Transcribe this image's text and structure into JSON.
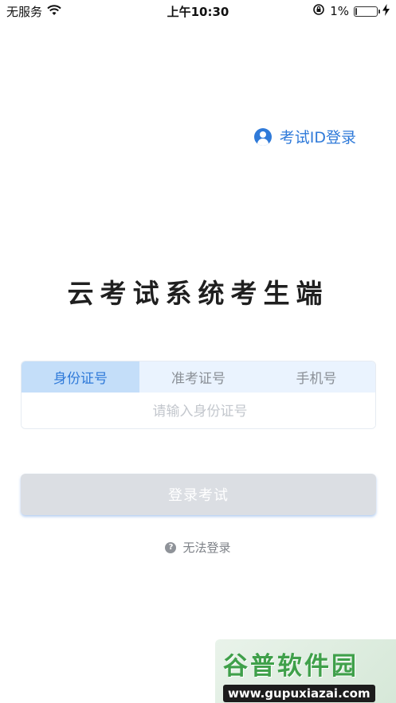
{
  "status_bar": {
    "carrier": "无服务",
    "time": "上午10:30",
    "battery_percent": "1%",
    "battery_level": 0.01
  },
  "exam_id_login": {
    "label": "考试ID登录",
    "icon": "user-icon",
    "color": "#2f7ad9"
  },
  "app_title": "云考试系统考生端",
  "login_tabs": [
    {
      "label": "身份证号",
      "active": true
    },
    {
      "label": "准考证号",
      "active": false
    },
    {
      "label": "手机号",
      "active": false
    }
  ],
  "id_input": {
    "placeholder": "请输入身份证号",
    "value": ""
  },
  "login_button": {
    "label": "登录考试"
  },
  "help": {
    "label": "无法登录",
    "icon": "question-icon"
  },
  "watermark": {
    "logo": "谷普软件园",
    "url": "www.gupuxiazai.com"
  },
  "colors": {
    "accent": "#2f7ad9",
    "tab_active_bg": "#c4def9",
    "tab_bg": "#eaf3fe",
    "button_disabled": "#dbdee3"
  }
}
